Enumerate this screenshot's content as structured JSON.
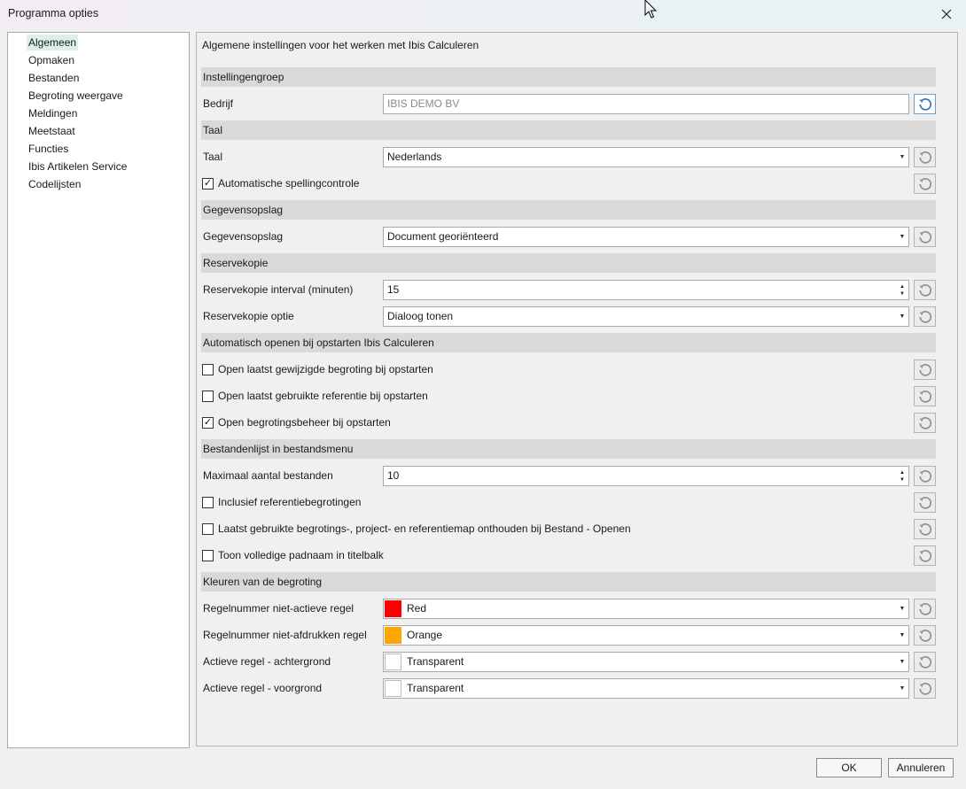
{
  "window": {
    "title": "Programma opties"
  },
  "sidebar": {
    "items": [
      {
        "label": "Algemeen",
        "selected": true
      },
      {
        "label": "Opmaken"
      },
      {
        "label": "Bestanden"
      },
      {
        "label": "Begroting weergave"
      },
      {
        "label": "Meldingen"
      },
      {
        "label": "Meetstaat"
      },
      {
        "label": "Functies"
      },
      {
        "label": "Ibis Artikelen Service"
      },
      {
        "label": "Codelijsten"
      }
    ]
  },
  "content": {
    "title": "Algemene instellingen voor het werken met Ibis Calculeren",
    "groups": {
      "instellingengroep": "Instellingengroep",
      "taal": "Taal",
      "gegevensopslag": "Gegevensopslag",
      "reservekopie": "Reservekopie",
      "autoopen": "Automatisch openen bij opstarten Ibis Calculeren",
      "bestandenlijst": "Bestandenlijst in bestandsmenu",
      "kleuren": "Kleuren van de begroting"
    },
    "fields": {
      "bedrijf": {
        "label": "Bedrijf",
        "value": "IBIS DEMO BV"
      },
      "taal": {
        "label": "Taal",
        "value": "Nederlands"
      },
      "spelling": {
        "label": "Automatische spellingcontrole",
        "checked": true
      },
      "gegevensopslag": {
        "label": "Gegevensopslag",
        "value": "Document georiënteerd"
      },
      "interval": {
        "label": "Reservekopie interval (minuten)",
        "value": "15"
      },
      "optie": {
        "label": "Reservekopie optie",
        "value": "Dialoog tonen"
      },
      "open_begroting": {
        "label": "Open laatst gewijzigde begroting bij opstarten",
        "checked": false
      },
      "open_referentie": {
        "label": "Open laatst gebruikte referentie bij opstarten",
        "checked": false
      },
      "open_beheer": {
        "label": "Open begrotingsbeheer bij opstarten",
        "checked": true
      },
      "max_bestanden": {
        "label": "Maximaal aantal bestanden",
        "value": "10"
      },
      "inclusief_ref": {
        "label": "Inclusief referentiebegrotingen",
        "checked": false
      },
      "laatst_map": {
        "label": "Laatst gebruikte begrotings-, project- en referentiemap onthouden bij Bestand - Openen",
        "checked": false
      },
      "volledige_pad": {
        "label": "Toon volledige padnaam in titelbalk",
        "checked": false
      },
      "kleur_nietactief": {
        "label": "Regelnummer niet-actieve regel",
        "value": "Red",
        "color": "#ff0000"
      },
      "kleur_nietafdrukken": {
        "label": "Regelnummer niet-afdrukken regel",
        "value": "Orange",
        "color": "#ffa500"
      },
      "kleur_achtergrond": {
        "label": "Actieve regel - achtergrond",
        "value": "Transparent",
        "color": "#ffffff"
      },
      "kleur_voorgrond": {
        "label": "Actieve regel - voorgrond",
        "value": "Transparent",
        "color": "#ffffff"
      }
    }
  },
  "buttons": {
    "ok": "OK",
    "cancel": "Annuleren"
  },
  "icons": {
    "close": "close-icon",
    "reset": "reset-icon",
    "cursor": "mouse-cursor-icon"
  },
  "colors": {
    "selected_nav": "#dcefed",
    "group_header": "#d9d9d9",
    "reset_active": "#2a6fb0"
  }
}
